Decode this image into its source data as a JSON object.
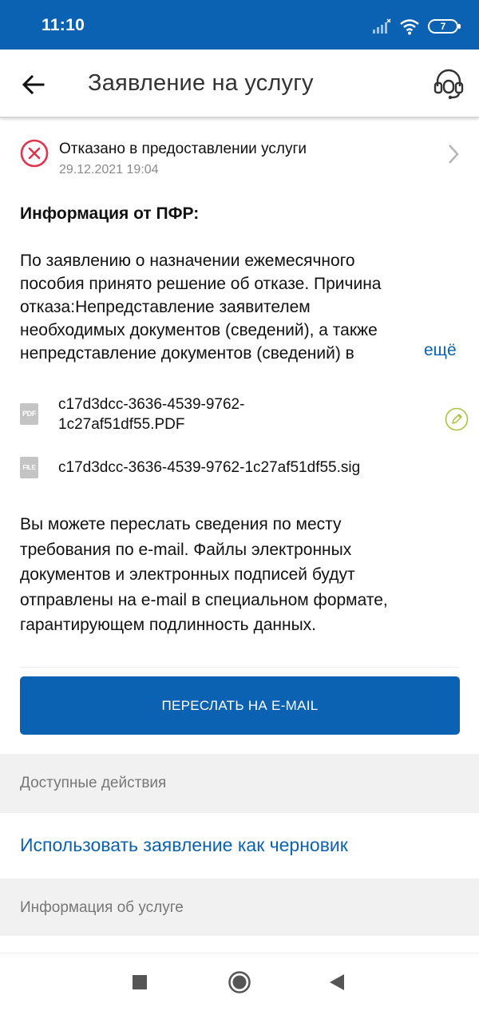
{
  "status_bar": {
    "time": "11:10",
    "battery": "7",
    "signal_icon": "signal-bars-icon",
    "wifi_icon": "wifi-icon"
  },
  "app_bar": {
    "title": "Заявление на услугу",
    "back_icon": "arrow-left-icon",
    "support_icon": "headset-icon"
  },
  "application_status": {
    "text": "Отказано в предоставлении услуги",
    "date": "29.12.2021 19:04",
    "icon": "rejected-circle-x-icon",
    "color": "#e0334d"
  },
  "info": {
    "heading": "Информация от ПФР:",
    "lines": [
      "По заявлению о назначении ежемесячного",
      "пособия принято решение об отказе. Причина",
      "отказа:Непредставление заявителем",
      "необходимых документов (сведений), а также",
      "непредставление документов (сведений) в"
    ],
    "more_label": "ещё"
  },
  "files": [
    {
      "badge": "PDF",
      "name_line1": "c17d3dcc-3636-4539-9762-",
      "name_line2": "1c27af51df55.PDF",
      "action_icon": "signature-pen-icon"
    },
    {
      "badge": "FILE",
      "name_line1": "c17d3dcc-3636-4539-9762-1c27af51df55.sig"
    }
  ],
  "email_note": {
    "lines": [
      "Вы можете переслать сведения по месту",
      "требования по e-mail. Файлы электронных",
      "документов и электронных подписей будут",
      "отправлены на e-mail в специальном формате,",
      "гарантирующем подлинность данных."
    ]
  },
  "send_button": {
    "label": "ПЕРЕСЛАТЬ НА E-MAIL"
  },
  "sections": {
    "available_actions": "Доступные действия",
    "use_as_draft": "Использовать заявление как черновик",
    "service_info": "Информация об услуге"
  },
  "colors": {
    "primary": "#0b62b3",
    "error": "#e0334d",
    "sign_accent": "#a9c23f",
    "section_bg": "#f1f1f1"
  },
  "nav": {
    "recents_icon": "square-recents-icon",
    "home_icon": "circle-home-icon",
    "back_icon": "triangle-back-icon"
  }
}
